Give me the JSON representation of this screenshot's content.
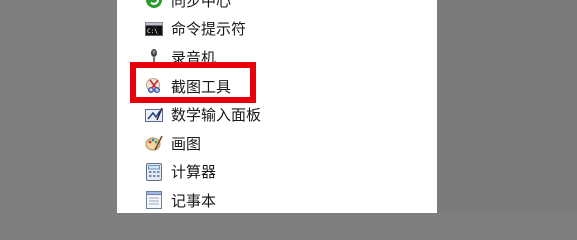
{
  "menu": {
    "items": [
      {
        "label": "同步中心",
        "icon": "sync-center-icon"
      },
      {
        "label": "命令提示符",
        "icon": "command-prompt-icon"
      },
      {
        "label": "录音机",
        "icon": "microphone-icon"
      },
      {
        "label": "截图工具",
        "icon": "snipping-tool-icon"
      },
      {
        "label": "数学输入面板",
        "icon": "math-input-panel-icon"
      },
      {
        "label": "画图",
        "icon": "paint-icon"
      },
      {
        "label": "计算器",
        "icon": "calculator-icon"
      },
      {
        "label": "记事本",
        "icon": "notepad-icon"
      }
    ]
  },
  "colors": {
    "highlight": "#e8000b",
    "panel": "#ffffff",
    "background": "#7f7f7f"
  }
}
